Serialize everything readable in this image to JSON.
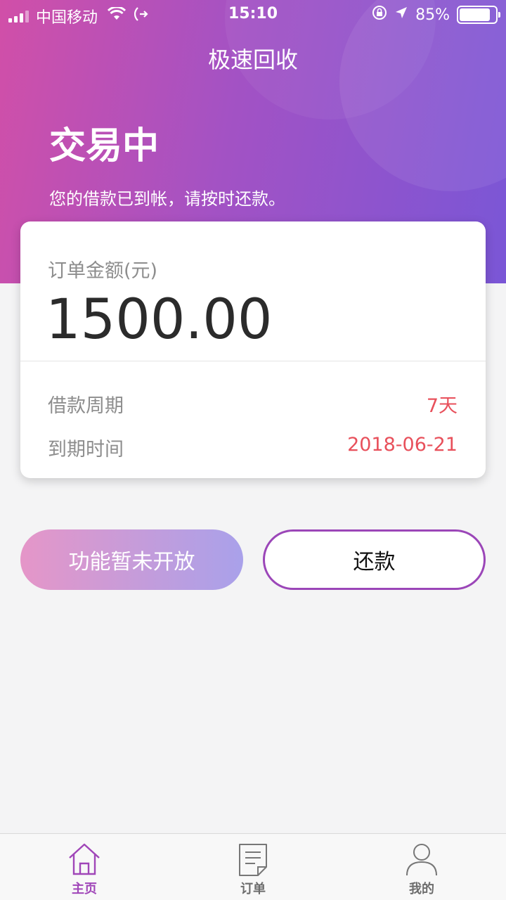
{
  "status_bar": {
    "carrier": "中国移动",
    "time": "15:10",
    "battery": "85%",
    "battery_level": 0.85
  },
  "header": {
    "title": "极速回收",
    "status_title": "交易中",
    "status_message": "您的借款已到帐，请按时还款。"
  },
  "order_card": {
    "amount_label": "订单金额(元)",
    "amount": "1500.00",
    "rows": [
      {
        "label": "借款周期",
        "value": "7天"
      },
      {
        "label": "到期时间",
        "value": "2018-06-21"
      }
    ]
  },
  "actions": {
    "disabled_label": "功能暂未开放",
    "repay_label": "还款"
  },
  "tabbar": {
    "items": [
      {
        "label": "主页",
        "icon": "home-icon",
        "active": true
      },
      {
        "label": "订单",
        "icon": "document-icon",
        "active": false
      },
      {
        "label": "我的",
        "icon": "person-icon",
        "active": false
      }
    ]
  },
  "colors": {
    "accent": "#a046b8",
    "value_red": "#e8505b",
    "gradient_start": "#d14fa8",
    "gradient_end": "#7a56d6"
  }
}
